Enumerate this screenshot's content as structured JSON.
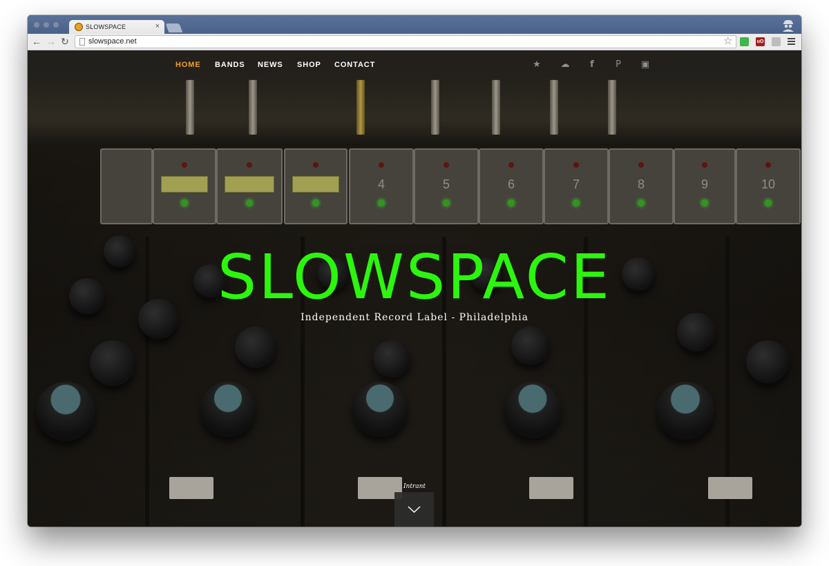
{
  "browser": {
    "tab": {
      "title": "SLOWSPACE",
      "close_glyph": "×",
      "favicon": "slowspace-favicon"
    },
    "toolbar": {
      "back_glyph": "←",
      "forward_glyph": "→",
      "reload_glyph": "↻",
      "url": "slowspace.net",
      "star_glyph": "☆"
    },
    "extensions": [
      {
        "name": "green-extension-icon",
        "color": "#3fb54a"
      },
      {
        "name": "ublock-extension-icon",
        "color": "#a3201d",
        "label": "uO"
      },
      {
        "name": "gray-extension-icon",
        "color": "#bdbdbd"
      }
    ]
  },
  "site": {
    "nav": {
      "items": [
        {
          "label": "HOME",
          "active": true
        },
        {
          "label": "BANDS",
          "active": false
        },
        {
          "label": "NEWS",
          "active": false
        },
        {
          "label": "SHOP",
          "active": false
        },
        {
          "label": "CONTACT",
          "active": false
        }
      ],
      "social": [
        {
          "icon": "twitter-icon",
          "glyph": "★"
        },
        {
          "icon": "soundcloud-icon",
          "glyph": "☁"
        },
        {
          "icon": "facebook-icon",
          "glyph": "f"
        },
        {
          "icon": "pinterest-icon",
          "glyph": "P"
        },
        {
          "icon": "instagram-icon",
          "glyph": "▣"
        }
      ]
    },
    "hero": {
      "title": "SLOWSPACE",
      "subtitle": "Independent Record Label - Philadelphia",
      "credit": "Intrant",
      "title_color": "#2cf50e"
    },
    "mixer_labels": [
      "4",
      "5",
      "6",
      "7",
      "8",
      "9",
      "10"
    ]
  },
  "colors": {
    "accent_nav": "#f19f2a",
    "hero_green": "#2cf50e"
  }
}
